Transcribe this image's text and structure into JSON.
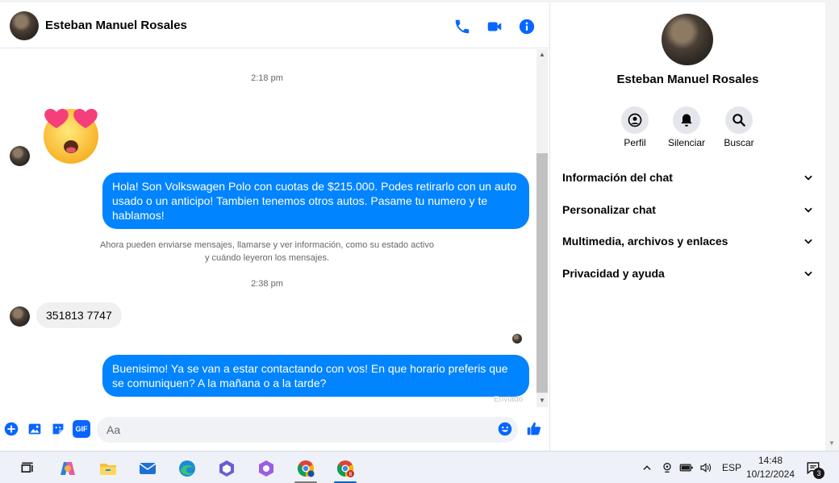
{
  "header": {
    "contact_name": "Esteban Manuel Rosales",
    "icons": [
      "phone-icon",
      "video-icon",
      "info-icon"
    ]
  },
  "messages": {
    "timestamp_1": "2:18 pm",
    "outgoing_1": "Hola! Son Volkswagen Polo con cuotas de $215.000. Podes retirarlo con un auto usado o un anticipo! Tambien tenemos otros autos. Pasame tu numero y te hablamos!",
    "system_note_line1": "Ahora pueden enviarse mensajes, llamarse y ver información, como su estado activo",
    "system_note_line2": "y cuándo leyeron los mensajes.",
    "timestamp_2": "2:38 pm",
    "incoming_1": "351813 7747",
    "outgoing_2": "Buenisimo! Ya se van a estar contactando con vos! En que horario preferis que se comuniquen? A la mañana o a la tarde?",
    "status": "Enviado"
  },
  "composer": {
    "placeholder": "Aa",
    "gif_label": "GIF"
  },
  "right_panel": {
    "name": "Esteban Manuel Rosales",
    "actions": [
      {
        "label": "Perfil",
        "icon": "profile-icon"
      },
      {
        "label": "Silenciar",
        "icon": "bell-icon"
      },
      {
        "label": "Buscar",
        "icon": "search-icon"
      }
    ],
    "sections": [
      {
        "label": "Información del chat"
      },
      {
        "label": "Personalizar chat"
      },
      {
        "label": "Multimedia, archivos y enlaces"
      },
      {
        "label": "Privacidad y ayuda"
      }
    ]
  },
  "taskbar": {
    "language": "ESP",
    "time": "14:48",
    "date": "10/12/2024",
    "notifications": "3",
    "chrome_badge": "B"
  },
  "colors": {
    "accent": "#0084ff",
    "icon_blue": "#0866ff"
  }
}
